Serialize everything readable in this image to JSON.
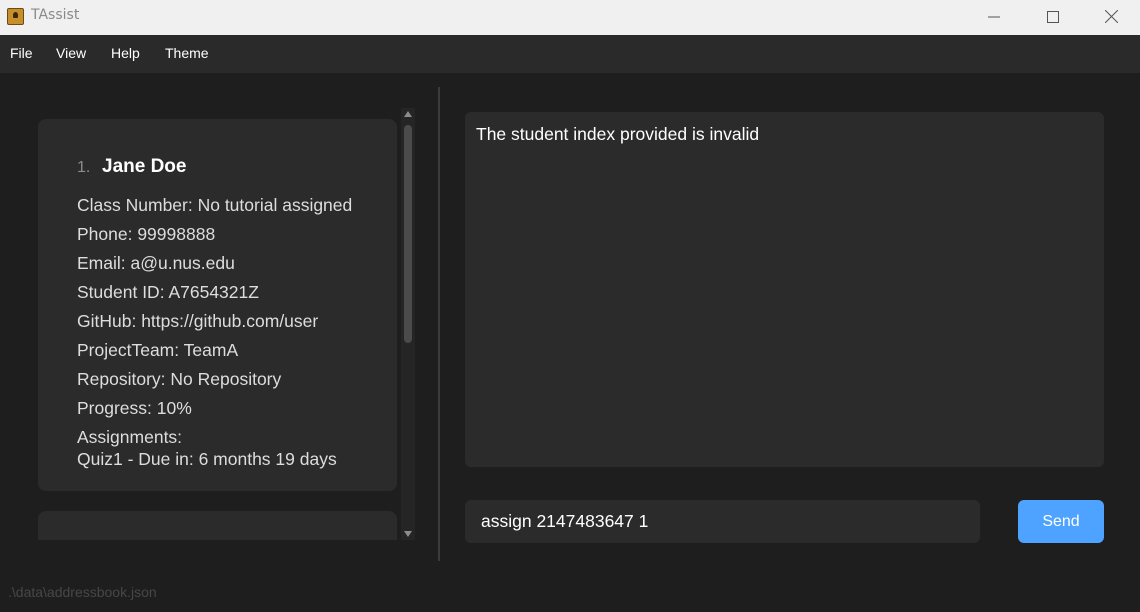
{
  "window": {
    "title": "TAssist",
    "icons": [
      "app-icon",
      "minimize-icon",
      "maximize-icon",
      "close-icon"
    ]
  },
  "menu": {
    "items": [
      {
        "label": "File"
      },
      {
        "label": "View"
      },
      {
        "label": "Help"
      },
      {
        "label": "Theme"
      }
    ]
  },
  "students": [
    {
      "index": "1.",
      "name": "Jane Doe",
      "class_number": "Class Number: No tutorial assigned",
      "phone": "Phone: 99998888",
      "email": "Email: a@u.nus.edu",
      "student_id": "Student ID: A7654321Z",
      "github": "GitHub: https://github.com/user",
      "project_team": "ProjectTeam: TeamA",
      "repository": "Repository: No Repository",
      "progress": "Progress: 10%",
      "assignments_label": "Assignments:",
      "assignments": [
        "Quiz1 - Due in: 6 months 19 days"
      ]
    }
  ],
  "result": {
    "message": "The student index provided is invalid"
  },
  "command": {
    "value": "assign 2147483647 1",
    "send_label": "Send"
  },
  "status": {
    "file_path": ".\\data\\addressbook.json"
  },
  "colors": {
    "background": "#1e1e1e",
    "panel": "#2b2b2b",
    "accent": "#4da3ff",
    "titlebar": "#f0f0f0"
  }
}
